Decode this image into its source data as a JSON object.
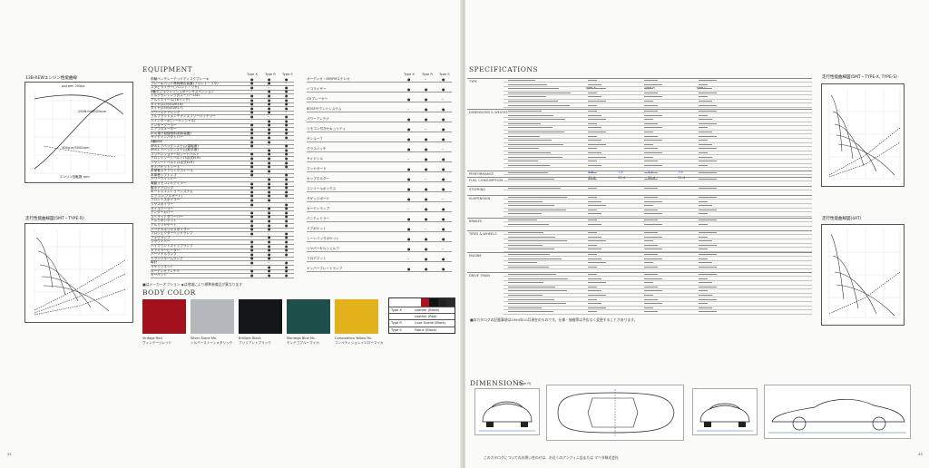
{
  "left_page": {
    "equipment_title": "EQUIPMENT",
    "engine_graph_title": "13B-REWエンジン性能曲線",
    "gear_graph_title": "走行性能曲線図(5MT・TYPE-R)",
    "engine_labels": {
      "power": "ps/rpm: 255ps",
      "torque": "294N·m/5000rpm",
      "torque_kgm": "30kg-m/5000rpm",
      "rpm": "エンジン回転数 rpm"
    },
    "columns_a": [
      "Type X",
      "Type R",
      "Type S"
    ],
    "columns_b": [
      "Type X",
      "Type R",
      "Type S"
    ],
    "equipment_left": [
      "前輪ベンチレーテッドディスクブレーキ",
      "ブレーキパッド摩耗警告装置(フロント・リヤ)",
      "スタビライザー(フロント・リヤ)",
      "4輪ダブルウィッシュボーンサスペンション",
      "トルクセンシング式スーパーLSD",
      "アルミホイール(16インチ)",
      "タイヤ(225/50ZR16)",
      "タイヤ(255/45ZR17)",
      "パワーステアリング",
      "フルフラットメンテナンスフリーバッテリー",
      "ツインターボ(シーケンシャル)",
      "インタークーラー",
      "エアフロメーター",
      "EGI(電子制御燃料噴射装置)",
      "サイドインパクトバー",
      "4輪ABS",
      "SRSエアバッグシステム(運転席)",
      "SRSエアバッグシステム(助手席)",
      "プリテンショナー付シートベルト",
      "フロントシートベルト(3点式ELR)",
      "リヤシートベルト(2点式ELR)",
      "セミバケットシート",
      "本革巻ステアリングホイール",
      "本革巻シフトノブ",
      "パワーウインドー",
      "電動リモコンドアミラー",
      "集中ドアロック",
      "キーレスエントリーシステム",
      "エアコン(フルオート)",
      "フロントスポイラー",
      "リヤスポイラー",
      "オイルクーラー",
      "アンダーカバー",
      "ストラットタワーバー",
      "アルミボンネット",
      "アルミリヤゲート",
      "バーチカルリヤスポイラー",
      "プロジェクターヘッドランプ",
      "フォグランプ",
      "リヤワイパー",
      "ハイマウントストップランプ",
      "ドアミラーヒーター",
      "パーソナルランプ",
      "トランクルームランプ",
      "時計",
      "ラゲッジネット",
      "オーディオアンテナ",
      "カーペット"
    ],
    "equipment_right": [
      "オーディオ・AM/FMステレオ",
      "イコライザー",
      "CDプレーヤー",
      "BOSEサウンドシステム",
      "パワーアンテナ",
      "リモコン付きセキュリティ",
      "サンルーフ",
      "グラスハッチ",
      "サイドシル",
      "マッドガード",
      "カップホルダー",
      "コンソールボックス",
      "ラゲッジボード",
      "カーテシランプ",
      "バニティミラー",
      "ドアポケット",
      "シートバックポケット",
      "リヤパーセルシェルフ",
      "フロアマット",
      "ナンバープレートランプ"
    ],
    "body_color_title": "BODY COLOR",
    "colors": [
      {
        "name": "Vintage Red",
        "jp": "ヴィンテージレッド",
        "hex": "#a3121c"
      },
      {
        "name": "Silver Stone Me.",
        "jp": "シルバーストーンメタリック",
        "hex": "#b4b7bb"
      },
      {
        "name": "Brilliant Black",
        "jp": "ブリリアントブラック",
        "hex": "#151618"
      },
      {
        "name": "Montego Blue Mc.",
        "jp": "モンテゴブルーマイカ",
        "hex": "#1f4f4a"
      },
      {
        "name": "Competition Yellow Mc.",
        "jp": "コンペティションイエローマイカ",
        "hex": "#e3b21a"
      }
    ],
    "trim_table": {
      "rows": [
        {
          "type": "Type X",
          "label": "Leather (Black)"
        },
        {
          "type": "",
          "label": "Leather (Red)"
        },
        {
          "type": "Type R",
          "label": "Luxe Suede (Black)"
        },
        {
          "type": "Type S",
          "label": "Fabric (Black)"
        }
      ]
    },
    "note": "■はメーカーオプション ◆は地域により標準装備品が異なります",
    "page_number": "22"
  },
  "right_page": {
    "spec_title": "SPECIFICATIONS",
    "sections": [
      "TYPE",
      "DIMENSIONS & WEIGHT",
      "PERFORMANCE",
      "FUEL CONSUMPTION",
      "STEERING",
      "SUSPENSION",
      "BRAKES",
      "TIRES & WHEELS",
      "ENGINE",
      "DRIVE TRAIN"
    ],
    "spec_columns": [
      "Type X",
      "Type R",
      "Type S"
    ],
    "fuel_values": [
      "7.8",
      "7.8",
      "7.7",
      "7.8"
    ],
    "fuel_values2": [
      "11.4",
      "11.4",
      "11.4",
      "11.4"
    ],
    "dimensions_title": "DIMENSIONS",
    "dimensions_sub": "(Type R)",
    "graph_right_1": "走行性能曲線図(5MT・TYPE-X, TYPE-S)",
    "graph_right_2": "走行性能曲線図(4AT)",
    "footnote": "■本カタログの記載事項は1994年10月現在のものです。仕様・価格等は予告なく変更することがあります。",
    "bottom_note": "このカタログについてのお問い合わせは、お近くのアンフィニ店または マツダ株式会社",
    "page_number": "43"
  }
}
